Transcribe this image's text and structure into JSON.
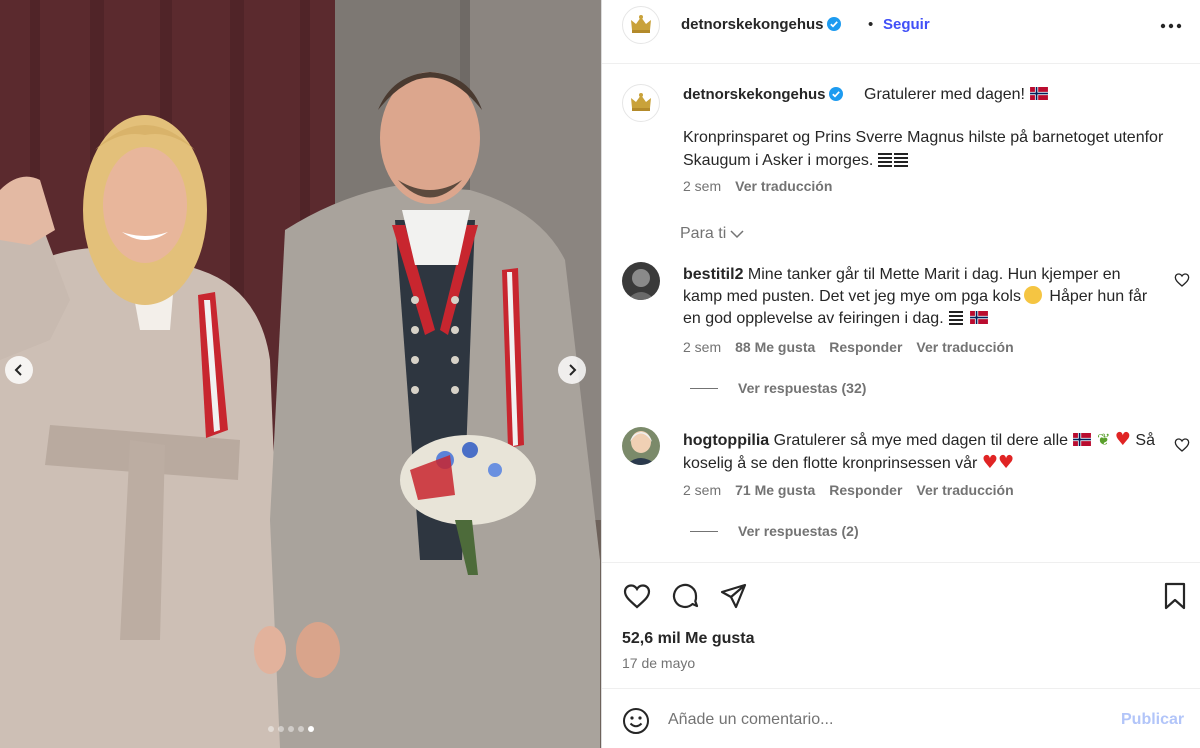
{
  "post": {
    "username": "detnorskekongehus",
    "follow_label": "Seguir",
    "separator": "•",
    "caption_first_line": "Gratulerer med dagen!",
    "caption_body": "Kronprinsparet og Prins Sverre Magnus hilste på barnetoget utenfor Skaugum i Asker i morges.",
    "caption_time": "2 sem",
    "caption_translate": "Ver traducción",
    "for_you_label": "Para ti",
    "likes": "52,6 mil Me gusta",
    "date": "17 de mayo"
  },
  "comments": [
    {
      "username": "bestitil2",
      "text": "Mine tanker går til Mette Marit i dag. Hun kjemper en kamp med pusten. Det vet jeg mye om pga kols",
      "text_tail": "Håper hun får en god opplevelse av feiringen i dag.",
      "time": "2 sem",
      "likes": "88 Me gusta",
      "reply_label": "Responder",
      "translate_label": "Ver traducción",
      "view_replies": "Ver respuestas (32)"
    },
    {
      "username": "hogtoppilia",
      "text": "Gratulerer så mye med dagen til dere alle",
      "text_tail": "Så koselig å se den flotte kronprinsessen vår",
      "time": "2 sem",
      "likes": "71 Me gusta",
      "reply_label": "Responder",
      "translate_label": "Ver traducción",
      "view_replies": "Ver respuestas (2)"
    }
  ],
  "comment_box": {
    "placeholder": "Añade un comentario...",
    "post_label": "Publicar"
  },
  "carousel": {
    "slide_count": 5,
    "active_index": 4
  },
  "icons": {
    "header": [
      "verified-icon",
      "more-options-icon"
    ],
    "actions": [
      "like-icon",
      "comment-icon",
      "share-icon",
      "save-icon"
    ],
    "other": [
      "crown-logo-icon",
      "chevron-down-icon",
      "heart-icon",
      "emoji-icon",
      "chevron-left-icon",
      "chevron-right-icon"
    ]
  },
  "colors": {
    "accent": "#4150f7",
    "post_disabled": "#b2c5f9",
    "muted": "#737373",
    "text": "#262626"
  }
}
